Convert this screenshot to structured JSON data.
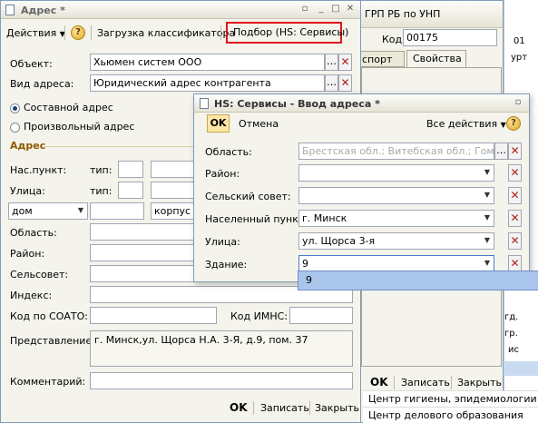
{
  "bg": {
    "tab_title": "ГРП РБ по УНП",
    "kod_label": "Код:",
    "kod_value": "00175",
    "tab_sport": "спорт",
    "tab_props": "Свойства",
    "ok": "OK",
    "save": "Записать",
    "close": "Закрыть",
    "list_items": [
      "Центр гигиены, эпидемиологии ...",
      "Центр делового образования"
    ],
    "edge_labels": [
      "01",
      "урт",
      "гд.",
      "гр.",
      "ис"
    ]
  },
  "addr": {
    "title": "Адрес *",
    "toolbar": {
      "actions": "Действия",
      "load": "Загрузка классификатора",
      "pick": "Подбор (HS: Сервисы)"
    },
    "object_label": "Объект:",
    "object_value": "Хьюмен систем ООО",
    "type_label": "Вид адреса:",
    "type_value": "Юридический адрес контрагента",
    "radio_compound": "Составной адрес",
    "radio_arbitrary": "Произвольный адрес",
    "section": "Адрес",
    "nas_label": "Нас.пункт:",
    "street_label": "Улица:",
    "tip_label": "тип:",
    "house_value": "дом",
    "korpus_value": "корпус",
    "region_label": "Область:",
    "district_label": "Район:",
    "selsovet_label": "Сельсовет:",
    "index_label": "Индекс:",
    "soato_label": "Код по СОАТО:",
    "imns_label": "Код ИМНС:",
    "repr_label": "Представление:",
    "repr_value": "г. Минск,ул. Щорса Н.А. 3-Я, д.9, пом. 37",
    "comment_label": "Комментарий:",
    "ok": "OK",
    "save": "Записать",
    "close": "Закрыть"
  },
  "hs": {
    "title": "HS: Сервисы - Ввод адреса *",
    "ok": "OK",
    "cancel": "Отмена",
    "all_actions": "Все действия",
    "fields": [
      {
        "label": "Область:",
        "value": "Брестская обл.; Витебская обл.; Гом...",
        "muted": true
      },
      {
        "label": "Район:",
        "value": ""
      },
      {
        "label": "Сельский совет:",
        "value": ""
      },
      {
        "label": "Населенный пункт:",
        "value": "г. Минск"
      },
      {
        "label": "Улица:",
        "value": "ул. Щорса 3-я"
      },
      {
        "label": "Здание:",
        "value": "9"
      }
    ],
    "dropdown_option": "9"
  }
}
